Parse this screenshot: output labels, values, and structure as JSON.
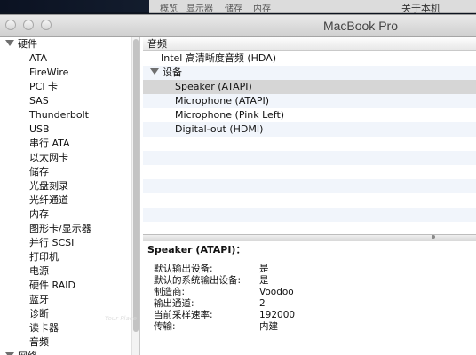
{
  "background": {
    "top_window_labels": [
      "概览",
      "显示器",
      "储存",
      "内存"
    ],
    "top_right_text": "关于本机"
  },
  "window": {
    "title": "MacBook Pro"
  },
  "sidebar": {
    "groups": [
      {
        "label": "硬件",
        "items": [
          "ATA",
          "FireWire",
          "PCI 卡",
          "SAS",
          "Thunderbolt",
          "USB",
          "串行 ATA",
          "以太网卡",
          "储存",
          "光盘刻录",
          "光纤通道",
          "内存",
          "图形卡/显示器",
          "并行 SCSI",
          "打印机",
          "电源",
          "硬件 RAID",
          "蓝牙",
          "诊断",
          "读卡器",
          "音频"
        ],
        "selected": "音频"
      },
      {
        "label": "网络",
        "items": []
      }
    ]
  },
  "main": {
    "section_header": "音频",
    "tree": {
      "root": "Intel 高清晰度音频 (HDA)",
      "group": "设备",
      "devices": [
        "Speaker (ATAPI)",
        "Microphone (ATAPI)",
        "Microphone (Pink Left)",
        "Digital-out (HDMI)"
      ],
      "selected": "Speaker (ATAPI)"
    },
    "detail": {
      "title": "Speaker (ATAPI)：",
      "rows": [
        {
          "key": "默认输出设备:",
          "value": "是"
        },
        {
          "key": "默认的系统输出设备:",
          "value": "是"
        },
        {
          "key": "制造商:",
          "value": "Voodoo"
        },
        {
          "key": "输出通道:",
          "value": "2"
        },
        {
          "key": "当前采样速率:",
          "value": "192000"
        },
        {
          "key": "传输:",
          "value": "内建"
        }
      ]
    }
  },
  "watermark": {
    "text": "Your Place"
  },
  "colors": {
    "selection": "#d6d6d6",
    "stripe": "#f1f5fb",
    "titlebar_top": "#e9e9e9",
    "titlebar_bottom": "#cfcfcf"
  }
}
